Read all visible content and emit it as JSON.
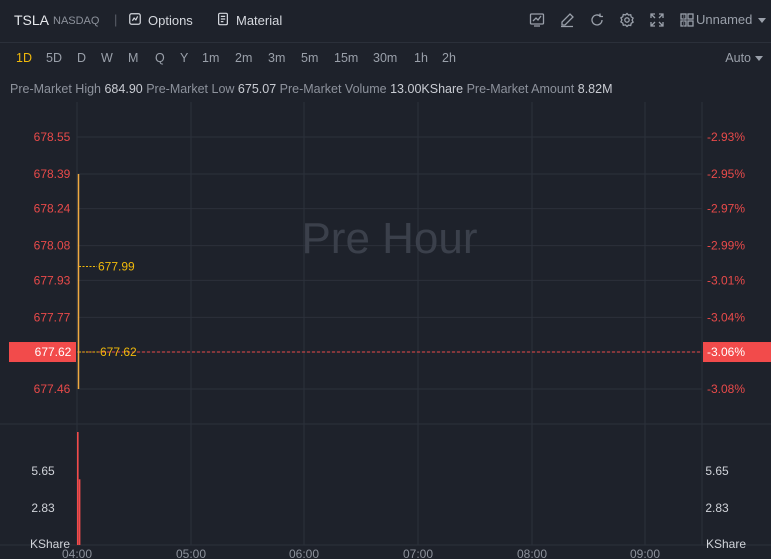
{
  "header": {
    "symbol": "TSLA",
    "exchange": "NASDAQ",
    "separator": "|",
    "options_label": "Options",
    "material_label": "Material",
    "layout_label": "Unnamed"
  },
  "intervals": [
    "1D",
    "5D",
    "D",
    "W",
    "M",
    "Q",
    "Y",
    "1m",
    "2m",
    "3m",
    "5m",
    "15m",
    "30m",
    "1h",
    "2h"
  ],
  "active_interval": "1D",
  "auto_label": "Auto",
  "stats": {
    "high_label": "Pre-Market High",
    "high_value": "684.90",
    "low_label": "Pre-Market Low",
    "low_value": "675.07",
    "volume_label": "Pre-Market Volume",
    "volume_value": "13.00KShare",
    "amount_label": "Pre-Market Amount",
    "amount_value": "8.82M"
  },
  "chart_data": {
    "type": "line",
    "watermark": "Pre Hour",
    "price_ticks": [
      "678.55",
      "678.39",
      "678.24",
      "678.08",
      "677.93",
      "677.77",
      "677.62",
      "677.46"
    ],
    "pct_ticks": [
      "-2.93%",
      "-2.95%",
      "-2.97%",
      "-2.99%",
      "-3.01%",
      "-3.04%",
      "-3.06%",
      "-3.08%"
    ],
    "current_price": "677.62",
    "current_pct": "-3.06%",
    "price_series": [
      {
        "time": "04:00",
        "price": 678.39
      },
      {
        "time": "04:00",
        "price": 677.62
      },
      {
        "time": "04:00",
        "price": 677.46
      }
    ],
    "avg_price_label": "677.99",
    "avg_price": 677.99,
    "last_price_label": "677.62",
    "last_price": 677.62,
    "volume_ticks": [
      "5.65",
      "2.83"
    ],
    "volume_unit": "KShare",
    "volume_bars": [
      8.6,
      5.0
    ],
    "time_ticks": [
      "04:00",
      "05:00",
      "06:00",
      "07:00",
      "08:00",
      "09:00"
    ],
    "colors": {
      "up": "#f0a940",
      "down": "#f24b4b",
      "avg": "#f0b90b",
      "grid": "#2c313b",
      "axis": "#e84a4a"
    }
  }
}
